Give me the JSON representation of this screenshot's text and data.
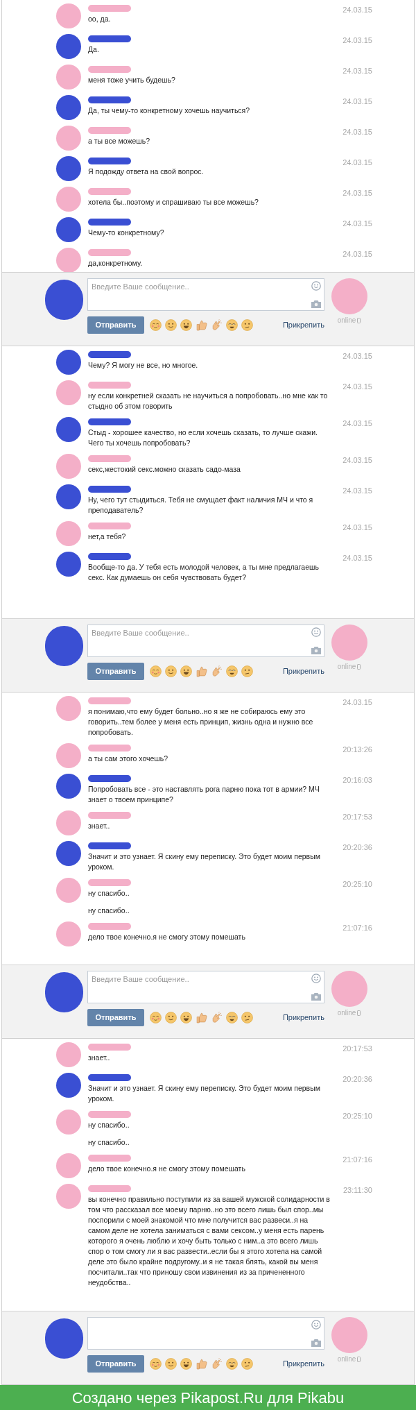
{
  "panels": [
    {
      "messages": [
        {
          "color": "#f4afc8",
          "time": "24.03.15",
          "texts": [
            "оо, да."
          ]
        },
        {
          "color": "#3a4fd3",
          "time": "24.03.15",
          "texts": [
            "Да."
          ]
        },
        {
          "color": "#f4afc8",
          "time": "24.03.15",
          "texts": [
            "меня тоже учить будешь?"
          ]
        },
        {
          "color": "#3a4fd3",
          "time": "24.03.15",
          "texts": [
            "Да, ты чему-то конкретному хочешь научиться?"
          ]
        },
        {
          "color": "#f4afc8",
          "time": "24.03.15",
          "texts": [
            "а ты все можешь?"
          ]
        },
        {
          "color": "#3a4fd3",
          "time": "24.03.15",
          "texts": [
            "Я подожду ответа на свой вопрос."
          ]
        },
        {
          "color": "#f4afc8",
          "time": "24.03.15",
          "texts": [
            "хотела бы..поэтому и спрашиваю ты все можешь?"
          ]
        },
        {
          "color": "#3a4fd3",
          "time": "24.03.15",
          "texts": [
            "Чему-то конкретному?"
          ]
        },
        {
          "color": "#f4afc8",
          "time": "24.03.15",
          "texts": [
            "да,конкретному."
          ]
        }
      ],
      "composer": {
        "placeholder": "Введите Ваше сообщение..",
        "send": "Отправить",
        "attach": "Прикрепить",
        "status": "online"
      }
    },
    {
      "messages": [
        {
          "color": "#3a4fd3",
          "time": "24.03.15",
          "texts": [
            "Чему? Я могу не все, но многое."
          ]
        },
        {
          "color": "#f4afc8",
          "time": "24.03.15",
          "texts": [
            "ну если конкретней сказать не научиться а попробовать..но мне как то стыдно об этом говорить"
          ]
        },
        {
          "color": "#3a4fd3",
          "time": "24.03.15",
          "texts": [
            "Стыд - хорошее качество, но если хочешь сказать, то лучше скажи. Чего ты хочешь попробовать?"
          ]
        },
        {
          "color": "#f4afc8",
          "time": "24.03.15",
          "texts": [
            "секс,жестокий секс.можно сказать садо-маза"
          ]
        },
        {
          "color": "#3a4fd3",
          "time": "24.03.15",
          "texts": [
            "Ну, чего тут стыдиться. Тебя не смущает факт наличия МЧ и что я преподаватель?"
          ]
        },
        {
          "color": "#f4afc8",
          "time": "24.03.15",
          "texts": [
            "нет,а тебя?"
          ]
        },
        {
          "color": "#3a4fd3",
          "time": "24.03.15",
          "texts": [
            "Вообще-то да. У тебя есть молодой человек, а ты мне предлагаешь секс. Как думаешь он себя чувствовать будет?"
          ]
        }
      ],
      "composer": {
        "placeholder": "Введите Ваше сообщение..",
        "send": "Отправить",
        "attach": "Прикрепить",
        "status": "online"
      }
    },
    {
      "messages": [
        {
          "color": "#f4afc8",
          "time": "24.03.15",
          "texts": [
            "я понимаю,что ему будет больно..но я же не собираюсь ему это говорить..тем более у меня есть принцип, жизнь одна и нужно все попробовать."
          ]
        },
        {
          "color": "#f4afc8",
          "time": "20:13:26",
          "texts": [
            "а ты сам этого хочешь?"
          ]
        },
        {
          "color": "#3a4fd3",
          "time": "20:16:03",
          "texts": [
            "Попробовать все - это наставлять рога парню пока тот в армии? МЧ знает о твоем принципе?"
          ]
        },
        {
          "color": "#f4afc8",
          "time": "20:17:53",
          "texts": [
            "знает.."
          ]
        },
        {
          "color": "#3a4fd3",
          "time": "20:20:36",
          "texts": [
            "Значит и это узнает. Я скину ему переписку. Это будет моим первым уроком."
          ]
        },
        {
          "color": "#f4afc8",
          "time": "20:25:10",
          "texts": [
            "ну спасибо..",
            "ну спасибо.."
          ]
        },
        {
          "color": "#f4afc8",
          "time": "21:07:16",
          "texts": [
            "дело твое конечно.я не смогу этому помешать"
          ]
        }
      ],
      "composer": {
        "placeholder": "Введите Ваше сообщение..",
        "send": "Отправить",
        "attach": "Прикрепить",
        "status": "online"
      }
    },
    {
      "messages": [
        {
          "color": "#f4afc8",
          "time": "20:17:53",
          "texts": [
            "знает.."
          ]
        },
        {
          "color": "#3a4fd3",
          "time": "20:20:36",
          "texts": [
            "Значит и это узнает. Я скину ему переписку. Это будет моим первым уроком."
          ]
        },
        {
          "color": "#f4afc8",
          "time": "20:25:10",
          "texts": [
            "ну спасибо..",
            "ну спасибо.."
          ]
        },
        {
          "color": "#f4afc8",
          "time": "21:07:16",
          "texts": [
            "дело твое конечно.я не смогу этому помешать"
          ]
        },
        {
          "color": "#f4afc8",
          "time": "23:11:30",
          "texts": [
            "вы конечно правильно поступили из за вашей мужской солидарности в том что рассказал все моему парню..но это всего лишь был спор..мы поспорили с моей знакомой что мне получится вас развеси..я на самом деле не хотела заниматься с вами сексом..у меня есть парень которого я очень люблю и хочу быть только с ним..а это всего лишь спор о том смогу ли я вас развести..если бы я этого хотела на самой деле это было крайне подругому..и я не такая блять, какой вы меня посчитали..так что приношу свои извинения из за причененного неудобства.."
          ]
        }
      ],
      "composer": {
        "send": "Отправить",
        "attach": "Прикрепить",
        "status": "online"
      }
    }
  ],
  "footer": "Создано через Pikapost.Ru для Pikabu"
}
